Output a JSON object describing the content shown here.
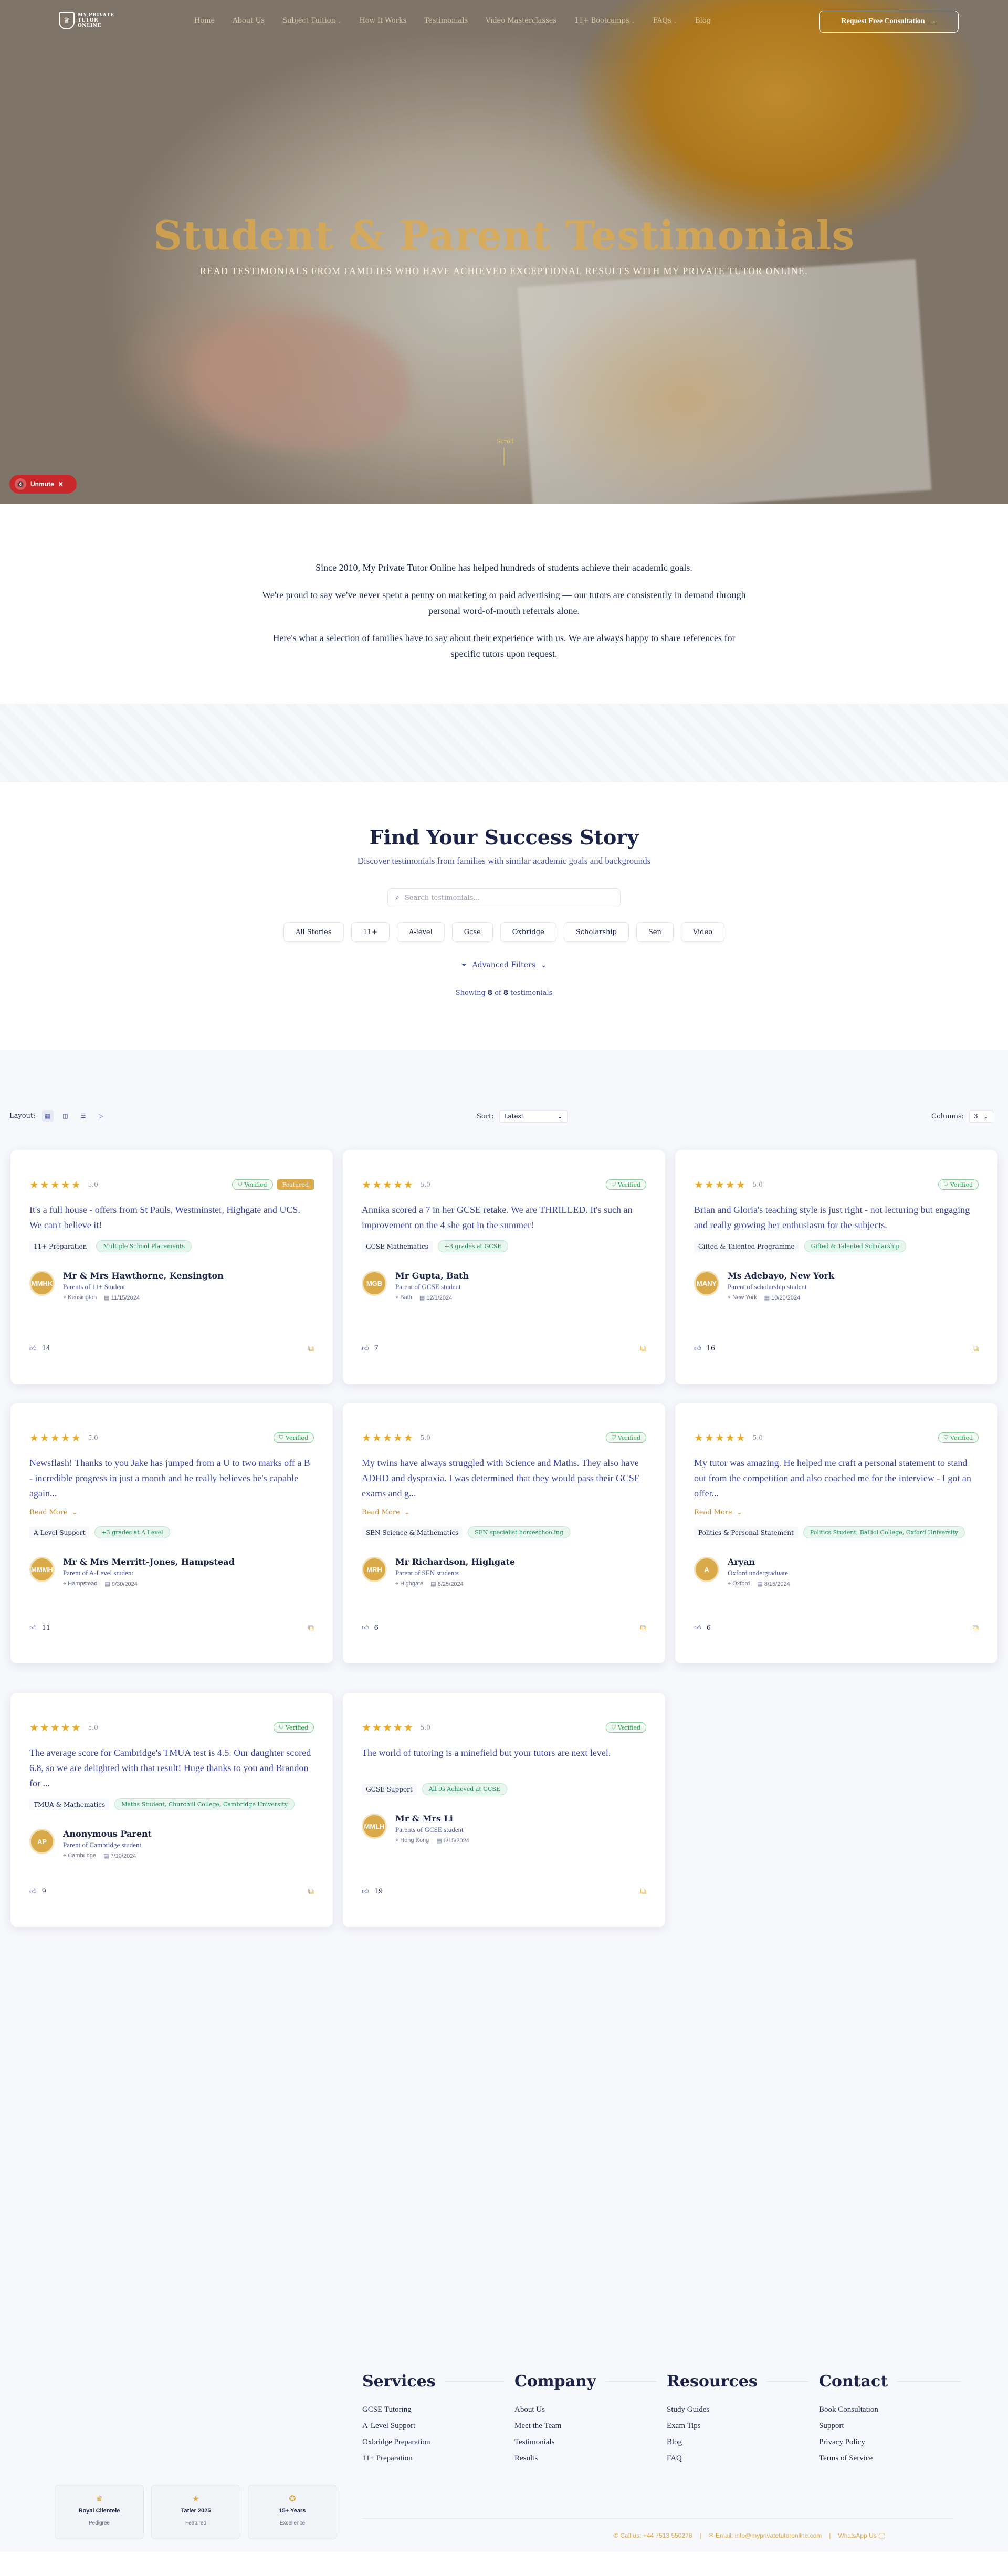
{
  "nav": {
    "logo_text": "MY PRIVATE TUTOR ONLINE",
    "links": [
      {
        "label": "Home",
        "chevron": false
      },
      {
        "label": "About Us",
        "chevron": false
      },
      {
        "label": "Subject Tuition",
        "chevron": true
      },
      {
        "label": "How It Works",
        "chevron": false
      },
      {
        "label": "Testimonials",
        "chevron": false
      },
      {
        "label": "Video Masterclasses",
        "chevron": false
      },
      {
        "label": "11+ Bootcamps",
        "chevron": true
      },
      {
        "label": "FAQs",
        "chevron": true
      },
      {
        "label": "Blog",
        "chevron": false
      }
    ],
    "cta_label": "Request Free Consultation"
  },
  "hero": {
    "title": "Student & Parent Testimonials",
    "subtitle": "READ TESTIMONIALS FROM FAMILIES WHO HAVE ACHIEVED EXCEPTIONAL RESULTS WITH MY PRIVATE TUTOR ONLINE.",
    "scroll_label": "Scroll",
    "unmute_label": "Unmute"
  },
  "intro": {
    "p1": "Since 2010, My Private Tutor Online has helped hundreds of students achieve their academic goals.",
    "p2": "We're proud to say we've never spent a penny on marketing or paid advertising — our tutors are consistently in demand through personal word-of-mouth referrals alone.",
    "p3": "Here's what a selection of families have to say about their experience with us. We are always happy to share references for specific tutors upon request."
  },
  "search": {
    "title": "Find Your Success Story",
    "subtitle": "Discover testimonials from families with similar academic goals and backgrounds",
    "placeholder": "Search testimonials...",
    "chips": [
      "All Stories",
      "11+",
      "A-level",
      "Gcse",
      "Oxbridge",
      "Scholarship",
      "Sen",
      "Video"
    ],
    "advanced_label": "Advanced Filters",
    "showing_prefix": "Showing",
    "showing_count": "8",
    "showing_mid": "of",
    "showing_total": "8",
    "showing_suffix": "testimonials"
  },
  "toolbar": {
    "layout_label": "Layout:",
    "sort_label": "Sort:",
    "sort_value": "Latest",
    "columns_label": "Columns:",
    "columns_value": "3"
  },
  "cards": [
    {
      "stars": "★★★★★",
      "rating": "5.0",
      "verified": "Verified",
      "featured": "Featured",
      "quote": "It's a full house - offers from St Pauls, Westminster, Highgate and UCS. We can't believe it!",
      "readmore": "",
      "tag_plain": "11+ Preparation",
      "tag_green": "Multiple School Placements",
      "initials": "MMHK",
      "name": "Mr & Mrs Hawthorne, Kensington",
      "role": "Parents of 11+ Student",
      "location": "Kensington",
      "date": "11/15/2024",
      "likes": "14"
    },
    {
      "stars": "★★★★★",
      "rating": "5.0",
      "verified": "Verified",
      "featured": "",
      "quote": "Annika scored a 7 in her GCSE retake. We are THRILLED. It's such an improvement on the 4 she got in the summer!",
      "readmore": "",
      "tag_plain": "GCSE Mathematics",
      "tag_green": "+3 grades at GCSE",
      "initials": "MGB",
      "name": "Mr Gupta, Bath",
      "role": "Parent of GCSE student",
      "location": "Bath",
      "date": "12/1/2024",
      "likes": "7"
    },
    {
      "stars": "★★★★★",
      "rating": "5.0",
      "verified": "Verified",
      "featured": "",
      "quote": "Brian and Gloria's teaching style is just right - not lecturing but engaging and really growing her enthusiasm for the subjects.",
      "readmore": "",
      "tag_plain": "Gifted & Talented Programme",
      "tag_green": "Gifted & Talented Scholarship",
      "initials": "MANY",
      "name": "Ms Adebayo, New York",
      "role": "Parent of scholarship student",
      "location": "New York",
      "date": "10/20/2024",
      "likes": "16"
    },
    {
      "stars": "★★★★★",
      "rating": "5.0",
      "verified": "Verified",
      "featured": "",
      "quote": "Newsflash! Thanks to you Jake has jumped from a U to two marks off a B - incredible progress in just a month and he really believes he's capable again...",
      "readmore": "Read More",
      "tag_plain": "A-Level Support",
      "tag_green": "+3 grades at A Level",
      "initials": "MMMH",
      "name": "Mr & Mrs Merritt-Jones, Hampstead",
      "role": "Parent of A-Level student",
      "location": "Hampstead",
      "date": "9/30/2024",
      "likes": "11"
    },
    {
      "stars": "★★★★★",
      "rating": "5.0",
      "verified": "Verified",
      "featured": "",
      "quote": "My twins have always struggled with Science and Maths. They also have ADHD and dyspraxia. I was determined that they would pass their GCSE exams and g...",
      "readmore": "Read More",
      "tag_plain": "SEN Science & Mathematics",
      "tag_green": "SEN specialist homeschooling",
      "initials": "MRH",
      "name": "Mr Richardson, Highgate",
      "role": "Parent of SEN students",
      "location": "Highgate",
      "date": "8/25/2024",
      "likes": "6"
    },
    {
      "stars": "★★★★★",
      "rating": "5.0",
      "verified": "Verified",
      "featured": "",
      "quote": "My tutor was amazing. He helped me craft a personal statement to stand out from the competition and also coached me for the interview - I got an offer...",
      "readmore": "Read More",
      "tag_plain": "Politics & Personal Statement",
      "tag_green": "Politics Student, Balliol College, Oxford University",
      "initials": "A",
      "name": "Aryan",
      "role": "Oxford undergraduate",
      "location": "Oxford",
      "date": "8/15/2024",
      "likes": "6"
    },
    {
      "stars": "★★★★★",
      "rating": "5.0",
      "verified": "Verified",
      "featured": "",
      "quote": "The average score for Cambridge's TMUA test is 4.5. Our daughter scored 6.8, so we are delighted with that result! Huge thanks to you and Brandon for ...",
      "readmore": "",
      "tag_plain": "TMUA & Mathematics",
      "tag_green": "Maths Student, Churchill College, Cambridge University",
      "initials": "AP",
      "name": "Anonymous Parent",
      "role": "Parent of Cambridge student",
      "location": "Cambridge",
      "date": "7/10/2024",
      "likes": "9"
    },
    {
      "stars": "★★★★★",
      "rating": "5.0",
      "verified": "Verified",
      "featured": "",
      "quote": "The world of tutoring is a minefield but your tutors are next level.",
      "readmore": "",
      "tag_plain": "GCSE Support",
      "tag_green": "All 9s Achieved at GCSE",
      "initials": "MMLH",
      "name": "Mr & Mrs Li",
      "role": "Parents of GCSE student",
      "location": "Hong Kong",
      "date": "6/15/2024",
      "likes": "19"
    }
  ],
  "footer": {
    "columns": [
      {
        "title": "Services",
        "links": [
          "GCSE Tutoring",
          "A-Level Support",
          "Oxbridge Preparation",
          "11+ Preparation"
        ]
      },
      {
        "title": "Company",
        "links": [
          "About Us",
          "Meet the Team",
          "Testimonials",
          "Results"
        ]
      },
      {
        "title": "Resources",
        "links": [
          "Study Guides",
          "Exam Tips",
          "Blog",
          "FAQ"
        ]
      },
      {
        "title": "Contact",
        "links": [
          "Book Consultation",
          "Support",
          "Privacy Policy",
          "Terms of Service"
        ]
      }
    ],
    "badges": [
      {
        "title": "Royal Clientele",
        "sub": "Pedigree"
      },
      {
        "title": "Tatler 2025",
        "sub": "Featured"
      },
      {
        "title": "15+ Years",
        "sub": "Excellence"
      }
    ],
    "phone": "Call us: +44 7513 550278",
    "email": "Email: info@myprivatetutoronline.com",
    "whatsapp": "WhatsApp Us"
  },
  "colors": {
    "accent_gold": "#d9a94a",
    "navy": "#1b2349",
    "link_blue": "#3a45a0",
    "verified_green": "#2a9b4c"
  }
}
